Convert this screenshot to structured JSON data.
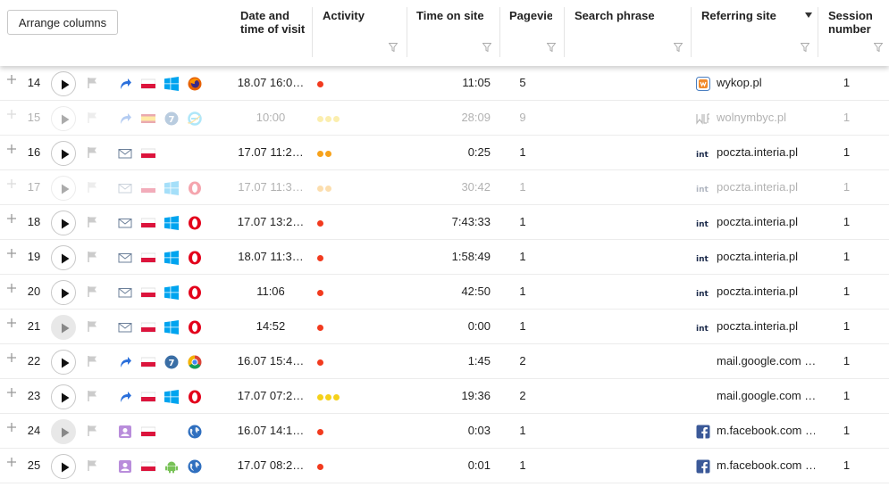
{
  "toolbar": {
    "arrange_label": "Arrange columns"
  },
  "columns": {
    "date": "Date and time of visit",
    "activity": "Activity",
    "time_on_site": "Time on site",
    "pageviews": "Pagevie",
    "search_phrase": "Search phrase",
    "referring_site": "Referring site",
    "session_number": "Session number"
  },
  "colors": {
    "dot_red": "#f23a1e",
    "dot_orange": "#f7a21b",
    "dot_yellow": "#f5d11a",
    "link_blue": "#2a6fdb"
  },
  "rows": [
    {
      "num": "14",
      "faded": false,
      "play": "white",
      "icons": [
        "referral-arrow-icon",
        "flag-poland-icon",
        "windows-icon",
        "firefox-icon"
      ],
      "date": "18.07 16:0…",
      "activity": "red1",
      "time": "11:05",
      "pageviews": "5",
      "ref_icon": "wykop-icon",
      "referrer": "wykop.pl",
      "session": "1"
    },
    {
      "num": "15",
      "faded": true,
      "play": "white",
      "icons": [
        "referral-arrow-icon",
        "flag-spain-icon",
        "windows7-icon",
        "ie-icon"
      ],
      "date": "10:00",
      "activity": "yellow3",
      "time": "28:09",
      "pageviews": "9",
      "ref_icon": "wolnymbyc-icon",
      "referrer": "wolnymbyc.pl",
      "session": "1"
    },
    {
      "num": "16",
      "faded": false,
      "play": "white",
      "icons": [
        "mail-icon",
        "flag-poland-icon",
        "",
        ""
      ],
      "date": "17.07 11:2…",
      "activity": "orange2",
      "time": "0:25",
      "pageviews": "1",
      "ref_icon": "interia-icon",
      "referrer": "poczta.interia.pl",
      "session": "1"
    },
    {
      "num": "17",
      "faded": true,
      "play": "white",
      "icons": [
        "mail-icon",
        "flag-poland-icon",
        "windows-icon",
        "opera-icon"
      ],
      "date": "17.07 11:3…",
      "activity": "orange2",
      "time": "30:42",
      "pageviews": "1",
      "ref_icon": "interia-icon",
      "referrer": "poczta.interia.pl",
      "session": "1"
    },
    {
      "num": "18",
      "faded": false,
      "play": "white",
      "icons": [
        "mail-icon",
        "flag-poland-icon",
        "windows-icon",
        "opera-icon"
      ],
      "date": "17.07 13:2…",
      "activity": "red1",
      "time": "7:43:33",
      "pageviews": "1",
      "ref_icon": "interia-icon",
      "referrer": "poczta.interia.pl",
      "session": "1"
    },
    {
      "num": "19",
      "faded": false,
      "play": "white",
      "icons": [
        "mail-icon",
        "flag-poland-icon",
        "windows-icon",
        "opera-icon"
      ],
      "date": "18.07 11:3…",
      "activity": "red1",
      "time": "1:58:49",
      "pageviews": "1",
      "ref_icon": "interia-icon",
      "referrer": "poczta.interia.pl",
      "session": "1"
    },
    {
      "num": "20",
      "faded": false,
      "play": "white",
      "icons": [
        "mail-icon",
        "flag-poland-icon",
        "windows-icon",
        "opera-icon"
      ],
      "date": "11:06",
      "activity": "red1",
      "time": "42:50",
      "pageviews": "1",
      "ref_icon": "interia-icon",
      "referrer": "poczta.interia.pl",
      "session": "1"
    },
    {
      "num": "21",
      "faded": false,
      "play": "grey",
      "icons": [
        "mail-icon",
        "flag-poland-icon",
        "windows-icon",
        "opera-icon"
      ],
      "date": "14:52",
      "activity": "red1",
      "time": "0:00",
      "pageviews": "1",
      "ref_icon": "interia-icon",
      "referrer": "poczta.interia.pl",
      "session": "1"
    },
    {
      "num": "22",
      "faded": false,
      "play": "white",
      "icons": [
        "referral-arrow-icon",
        "flag-poland-icon",
        "windows7-icon",
        "chrome-icon"
      ],
      "date": "16.07 15:4…",
      "activity": "red1",
      "time": "1:45",
      "pageviews": "2",
      "ref_icon": "",
      "referrer": "mail.google.com …",
      "session": "1"
    },
    {
      "num": "23",
      "faded": false,
      "play": "white",
      "icons": [
        "referral-arrow-icon",
        "flag-poland-icon",
        "windows-icon",
        "opera-icon"
      ],
      "date": "17.07 07:2…",
      "activity": "yellow3",
      "time": "19:36",
      "pageviews": "2",
      "ref_icon": "",
      "referrer": "mail.google.com …",
      "session": "1"
    },
    {
      "num": "24",
      "faded": false,
      "play": "grey",
      "icons": [
        "social-icon",
        "flag-poland-icon",
        "",
        "globe-icon"
      ],
      "date": "16.07 14:1…",
      "activity": "red1",
      "time": "0:03",
      "pageviews": "1",
      "ref_icon": "facebook-icon",
      "referrer": "m.facebook.com …",
      "session": "1"
    },
    {
      "num": "25",
      "faded": false,
      "play": "white",
      "icons": [
        "social-icon",
        "flag-poland-icon",
        "android-icon",
        "globe-icon"
      ],
      "date": "17.07 08:2…",
      "activity": "red1",
      "time": "0:01",
      "pageviews": "1",
      "ref_icon": "facebook-icon",
      "referrer": "m.facebook.com …",
      "session": "1"
    }
  ]
}
